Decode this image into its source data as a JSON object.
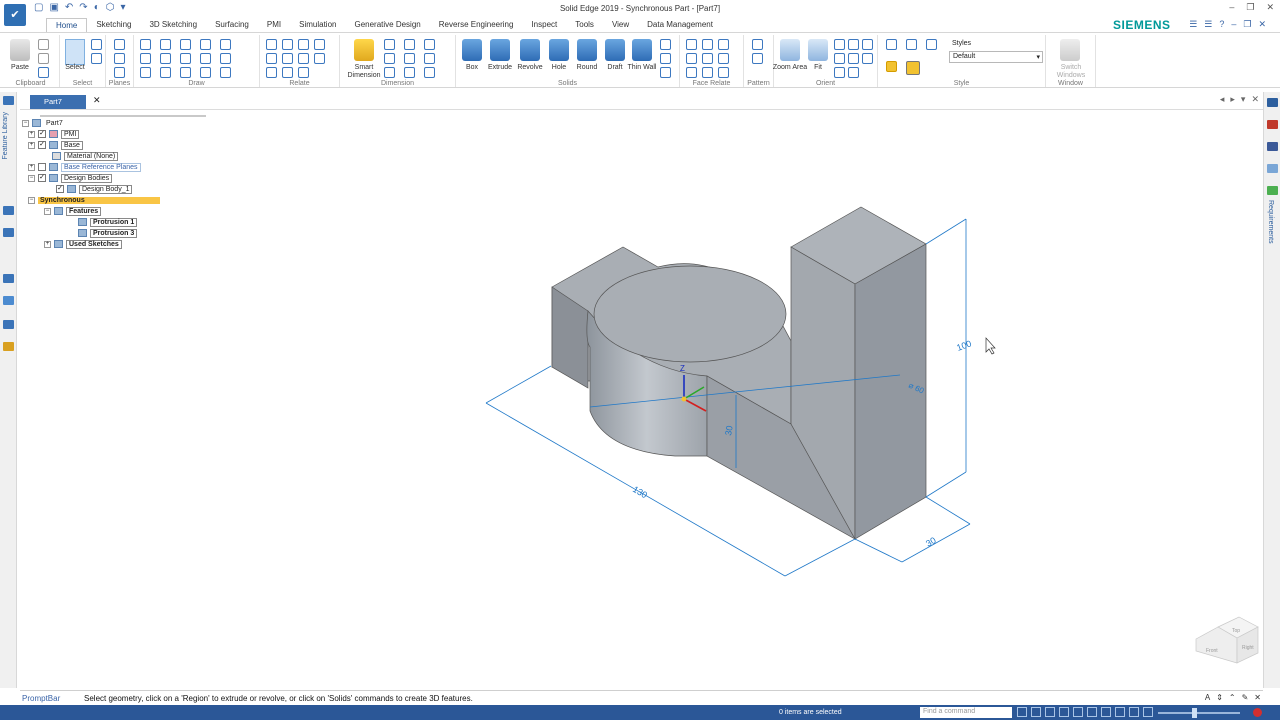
{
  "app": {
    "title": "Solid Edge 2019 - Synchronous Part - [Part7]",
    "brand": "SIEMENS"
  },
  "ribbon_tabs": [
    "Home",
    "Sketching",
    "3D Sketching",
    "Surfacing",
    "PMI",
    "Simulation",
    "Generative Design",
    "Reverse Engineering",
    "Inspect",
    "Tools",
    "View",
    "Data Management"
  ],
  "ribbon": {
    "paste": "Paste",
    "select": "Select",
    "groups": {
      "clipboard": "Clipboard",
      "select": "Select",
      "planes": "Planes",
      "draw": "Draw",
      "relate": "Relate",
      "dimension": "Dimension",
      "solids": "Solids",
      "face_relate": "Face Relate",
      "pattern": "Pattern",
      "orient": "Orient",
      "style": "Style",
      "window": "Window"
    },
    "smart_dimension": "Smart Dimension",
    "solids": [
      "Box",
      "Extrude",
      "Revolve",
      "Hole",
      "Round",
      "Draft",
      "Thin Wall"
    ],
    "zoom_area": "Zoom Area",
    "fit": "Fit",
    "styles_label": "Styles",
    "styles_value": "Default",
    "switch_windows": "Switch Windows"
  },
  "doc_tab": "Part7",
  "left_strip": {
    "feature_library": "Feature Library"
  },
  "right_strip": {
    "requirements": "Requirements"
  },
  "tree": {
    "root": "Part7",
    "pmi": "PMI",
    "base": "Base",
    "material": "Material (None)",
    "base_ref": "Base Reference Planes",
    "design_bodies": "Design Bodies",
    "design_body": "Design Body_1",
    "synchronous": "Synchronous",
    "features": "Features",
    "protrusion1": "Protrusion 1",
    "protrusion3": "Protrusion 3",
    "used_sketches": "Used Sketches"
  },
  "model": {
    "dim_length": "130",
    "dim_height": "100",
    "dim_width": "30",
    "dim_depth": "30",
    "dim_diameter": "⌀ 60",
    "axis_z": "Z"
  },
  "view_cube": {
    "top": "Top",
    "front": "Front",
    "right": "Right"
  },
  "prompt": {
    "label": "PromptBar",
    "text": "Select geometry, click on a 'Region' to extrude or revolve, or click on 'Solids' commands to create 3D features."
  },
  "status": {
    "count": "0 items are selected",
    "find_placeholder": "Find a command"
  },
  "colors": {
    "accent": "#2b5797",
    "brand": "#009999",
    "dimension": "#1f78c8",
    "highlight": "#f9c545"
  }
}
